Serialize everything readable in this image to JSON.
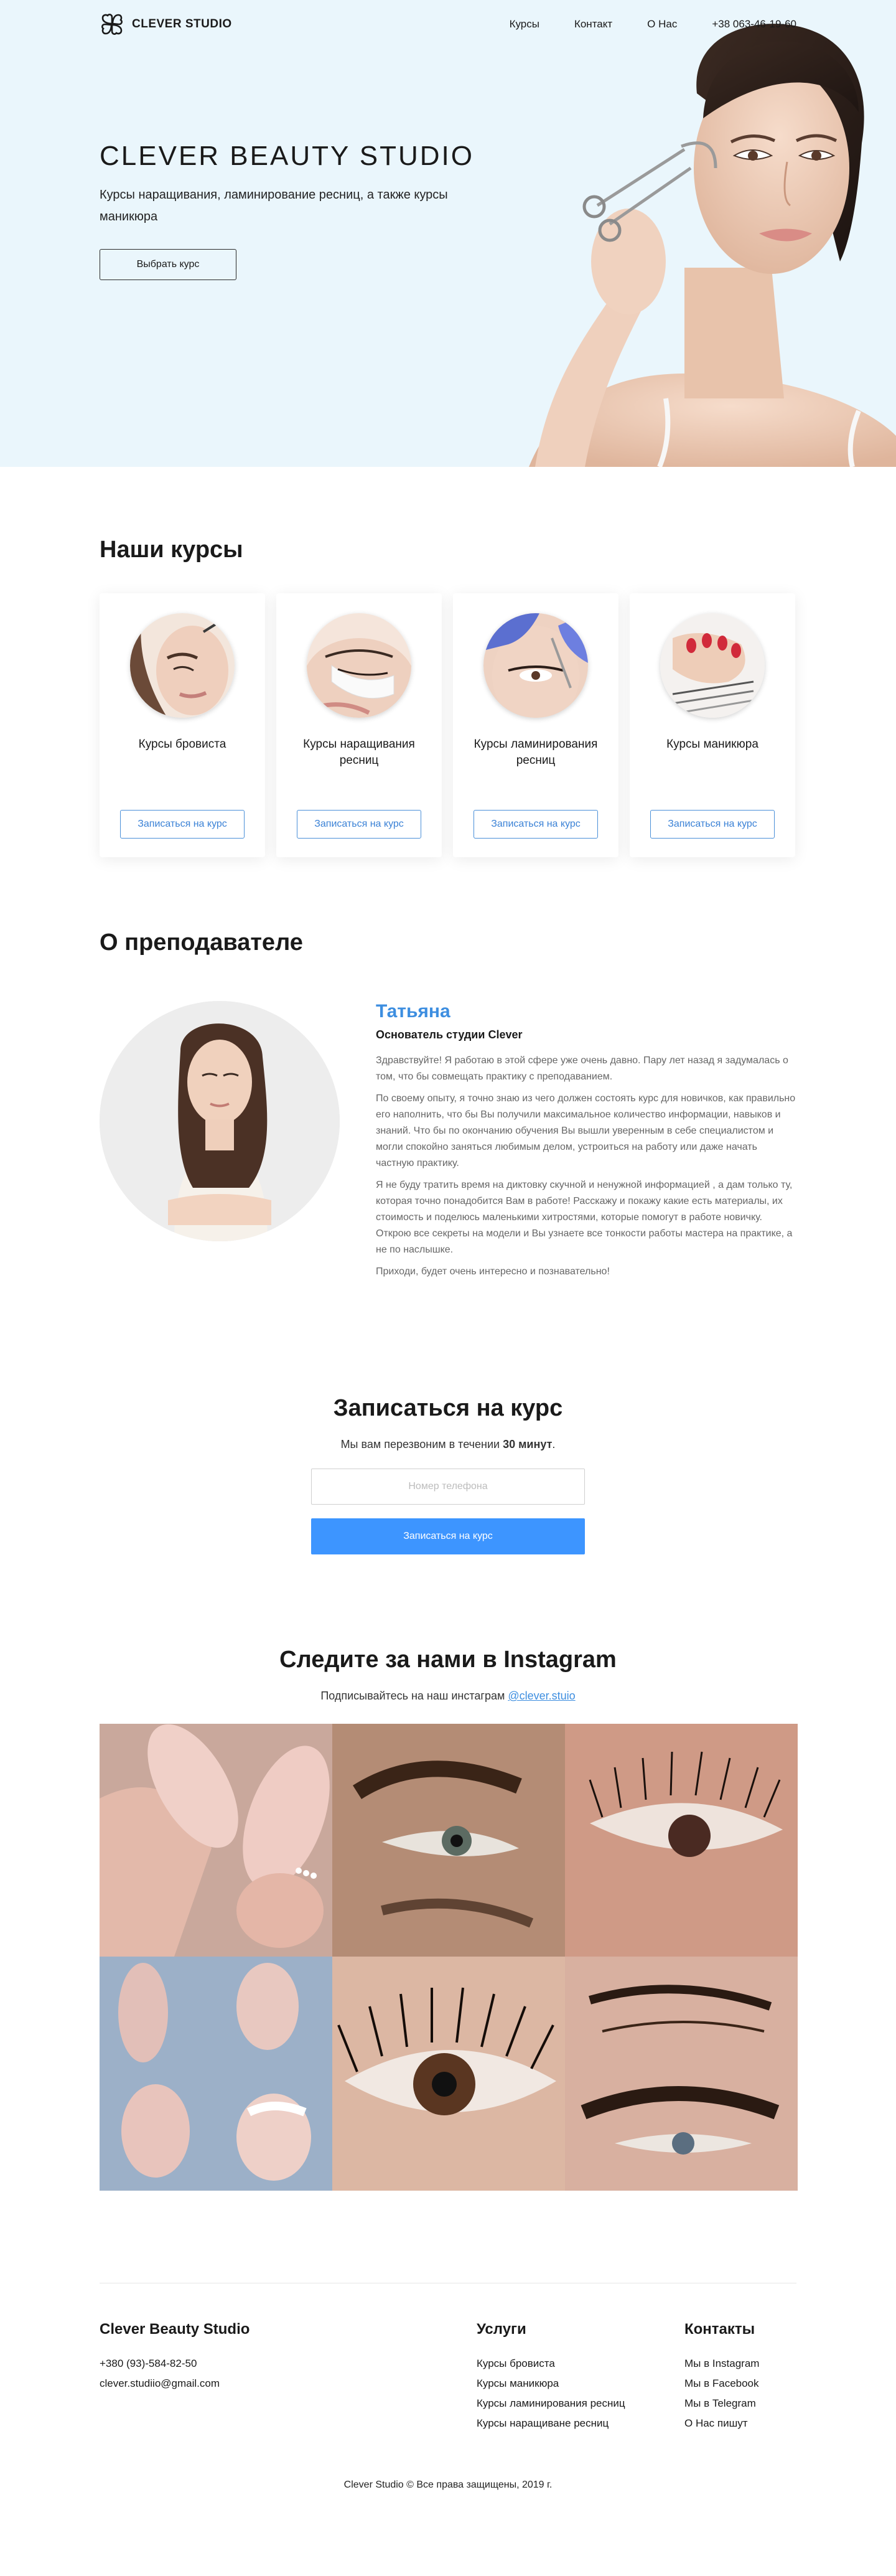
{
  "header": {
    "logo_text": "CLEVER STUDIO",
    "menu": [
      {
        "label": "Курсы"
      },
      {
        "label": "Контакт"
      },
      {
        "label": "О Нас"
      },
      {
        "label": "+38 063-46-19-60"
      }
    ]
  },
  "hero": {
    "title": "CLEVER BEAUTY STUDIO",
    "subtitle": "Курсы наращивания, ламинирование ресниц, а также курсы маникюра",
    "cta": "Выбрать курс"
  },
  "courses": {
    "title": "Наши курсы",
    "items": [
      {
        "name": "Курсы бровиста",
        "button": "Записаться на курс"
      },
      {
        "name": "Курсы наращивания ресниц",
        "button": "Записаться на курс"
      },
      {
        "name": "Курсы ламинирования ресниц",
        "button": "Записаться на курс"
      },
      {
        "name": "Курсы маникюра",
        "button": "Записаться на курс"
      }
    ]
  },
  "teacher": {
    "title": "О преподавателе",
    "name": "Татьяна",
    "role": "Основатель студии Clever",
    "paragraphs": [
      "Здравствуйте! Я работаю в этой сфере уже очень давно. Пару лет назад я задумалась о том, что бы совмещать практику с преподаванием.",
      "По своему опыту, я точно знаю из чего должен состоять курс для новичков, как правильно его наполнить, что бы Вы получили максимальное количество информации, навыков и знаний. Что бы по окончанию обучения Вы вышли уверенным в себе специалистом и могли спокойно заняться любимым делом, устроиться на работу или даже начать частную практику.",
      "Я не буду тратить время на диктовку скучной и ненужной информацией , а дам только ту, которая точно понадобится Вам в работе! Расскажу и покажу какие есть материалы, их стоимость и поделюсь маленькими хитростями, которые помогут в работе новичку. Открою все секреты на модели и Вы узнаете все тонкости работы мастера на практике, а не по наслышке.",
      "Приходи, будет очень интересно и познавательно!"
    ]
  },
  "signup": {
    "title": "Записаться на курс",
    "subtitle_pre": "Мы вам перезвоним в течении ",
    "subtitle_bold": "30 минут",
    "subtitle_post": ".",
    "phone_placeholder": "Номер телефона",
    "button": "Записаться на курс",
    "accent": "#3d95ff"
  },
  "instagram": {
    "title": "Следите за нами в Instagram",
    "subtitle_pre": "Подписывайтесь на наш инстаграм ",
    "handle": "@clever.stuio"
  },
  "footer": {
    "col1_title": "Clever Beauty Studio",
    "phone": "+380 (93)-584-82-50",
    "email": "clever.studiio@gmail.com",
    "col2_title": "Услуги",
    "services": [
      "Курсы бровиста",
      "Курсы маникюра",
      "Курсы ламинирования ресниц",
      "Курсы наращиване ресниц"
    ],
    "col3_title": "Контакты",
    "contacts": [
      "Мы в Instagram",
      "Мы в Facebook",
      "Мы в Telegram",
      "О Нас пишут"
    ],
    "copyright": "Clever Studio © Все права защищены, 2019 г."
  }
}
